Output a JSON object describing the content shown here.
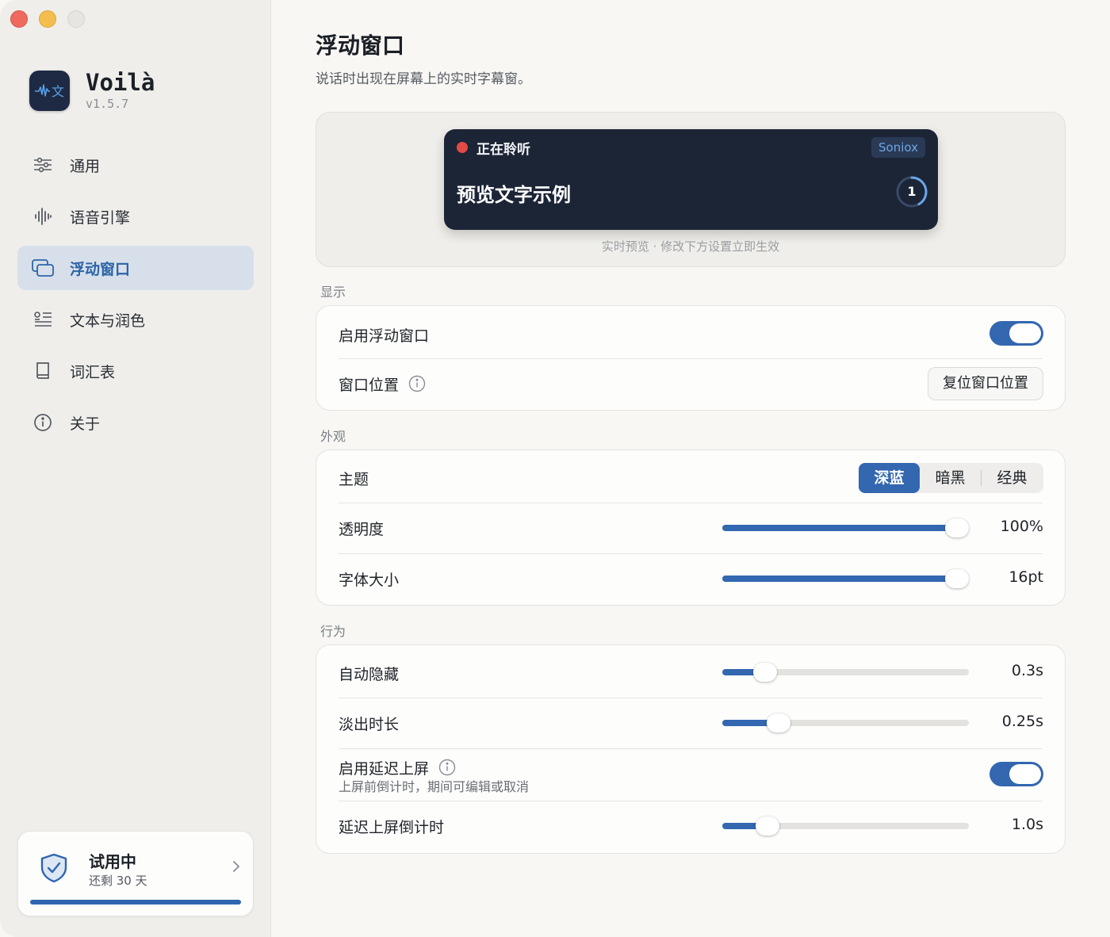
{
  "app": {
    "name": "Voilà",
    "version": "v1.5.7",
    "icon_name": "waveform-translate-icon"
  },
  "sidebar": {
    "items": [
      {
        "label": "通用",
        "icon": "sliders-icon",
        "active": false
      },
      {
        "label": "语音引擎",
        "icon": "waveform-icon",
        "active": false
      },
      {
        "label": "浮动窗口",
        "icon": "windows-icon",
        "active": true
      },
      {
        "label": "文本与润色",
        "icon": "text-list-icon",
        "active": false
      },
      {
        "label": "词汇表",
        "icon": "book-icon",
        "active": false
      },
      {
        "label": "关于",
        "icon": "info-icon",
        "active": false
      }
    ],
    "trial": {
      "title": "试用中",
      "subtitle": "还剩 30 天",
      "icon": "shield-check-icon",
      "progress": 1.0
    }
  },
  "page": {
    "title": "浮动窗口",
    "subtitle": "说话时出现在屏幕上的实时字幕窗。"
  },
  "preview": {
    "status": "正在聆听",
    "engine_badge": "Soniox",
    "sample_text": "预览文字示例",
    "countdown": "1",
    "hint": "实时预览 · 修改下方设置立即生效"
  },
  "display": {
    "section_label": "显示",
    "enable_label": "启用浮动窗口",
    "enable_on": true,
    "position_label": "窗口位置",
    "reset_button": "复位窗口位置"
  },
  "appearance": {
    "section_label": "外观",
    "theme_label": "主题",
    "themes": [
      "深蓝",
      "暗黑",
      "经典"
    ],
    "theme_selected": "深蓝",
    "opacity_label": "透明度",
    "opacity_value": "100%",
    "opacity_level": 1.0,
    "font_size_label": "字体大小",
    "font_size_value": "16pt",
    "font_size_level": 1.0
  },
  "behavior": {
    "section_label": "行为",
    "auto_hide_label": "自动隐藏",
    "auto_hide_value": "0.3s",
    "auto_hide_level": 0.14,
    "fade_label": "淡出时长",
    "fade_value": "0.25s",
    "fade_level": 0.2,
    "delay_label": "启用延迟上屏",
    "delay_sub": "上屏前倒计时，期间可编辑或取消",
    "delay_on": true,
    "countdown_label": "延迟上屏倒计时",
    "countdown_value": "1.0s",
    "countdown_level": 0.15
  },
  "colors": {
    "accent": "#3367b0",
    "preview_bg": "#1c2536",
    "recording_dot": "#e44a44"
  }
}
